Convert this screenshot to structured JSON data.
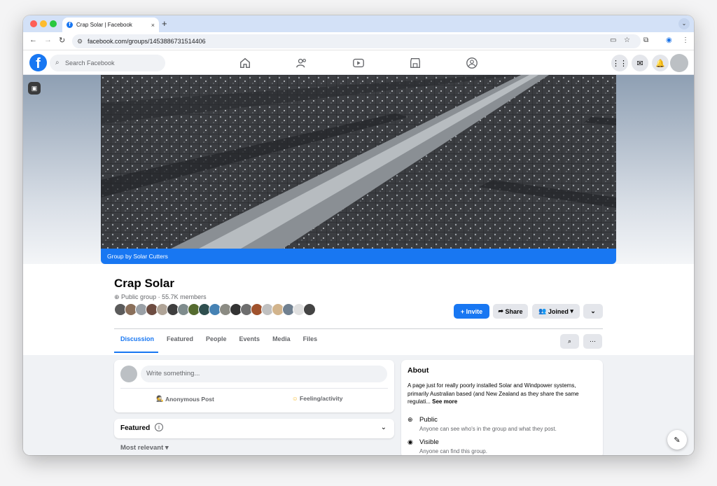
{
  "browser": {
    "tab_title": "Crap Solar | Facebook",
    "tab_close": "×",
    "new_tab": "+",
    "url": "facebook.com/groups/1453886731514406"
  },
  "fb_header": {
    "logo": "f",
    "search_placeholder": "Search Facebook",
    "nav_icons": [
      "home-icon",
      "friends-icon",
      "watch-icon",
      "marketplace-icon",
      "groups-icon"
    ]
  },
  "group": {
    "cover_caption_prefix": "Group by ",
    "cover_caption_owner": "Solar Cutters",
    "name": "Crap Solar",
    "meta": "Public group · 55.7K members",
    "member_face_colors": [
      "#5b5b5b",
      "#8a6f5a",
      "#9aa0a6",
      "#6d4c41",
      "#b0a497",
      "#3e3e3e",
      "#7f8c8d",
      "#556b2f",
      "#2f4f4f",
      "#4682b4",
      "#8b8b83",
      "#333333",
      "#6e6e6e",
      "#a0522d",
      "#c0c0c0",
      "#d2b48c",
      "#708090",
      "#e0e0e0",
      "#444444"
    ]
  },
  "actions": {
    "invite": "+ Invite",
    "share": "Share",
    "joined": "Joined",
    "more": "⌄"
  },
  "tabs": [
    "Discussion",
    "Featured",
    "People",
    "Events",
    "Media",
    "Files"
  ],
  "composer": {
    "placeholder": "Write something...",
    "anonymous": "Anonymous Post",
    "feeling": "Feeling/activity"
  },
  "featured": {
    "title": "Featured",
    "sort": "Most relevant"
  },
  "about": {
    "title": "About",
    "description": "A page just for really poorly installed Solar and Windpower systems, primarily Australian based (and New Zealand as they share the same regulati...",
    "see_more": "See more",
    "privacy_title": "Public",
    "privacy_desc": "Anyone can see who's in the group and what they post.",
    "visible_title": "Visible",
    "visible_desc": "Anyone can find this group."
  },
  "colors": {
    "brand": "#1877f2",
    "page_bg": "#f0f2f5"
  }
}
